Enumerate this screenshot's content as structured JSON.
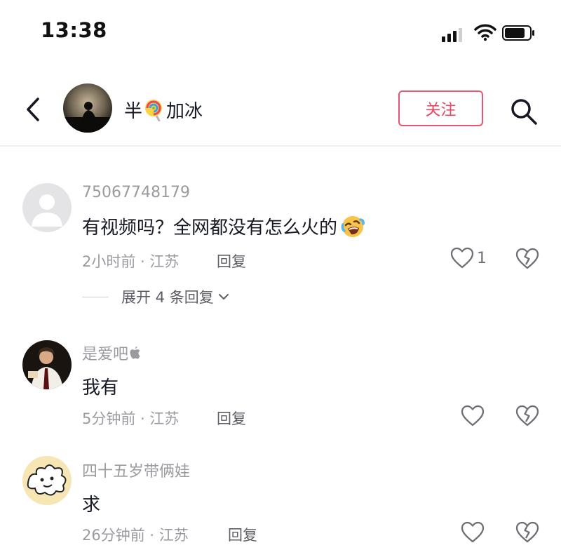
{
  "status_bar": {
    "time": "13:38"
  },
  "header": {
    "channel_name_prefix": "半",
    "channel_name_suffix": "加冰",
    "follow_label": "关注"
  },
  "comments": [
    {
      "username": "75067748179",
      "content": "有视频吗？全网都没有怎么火的",
      "time_location": "2小时前 · 江苏",
      "reply_label": "回复",
      "like_count": "1",
      "expand_label": "展开 4 条回复"
    },
    {
      "username": "是爱吧",
      "content": "我有",
      "time_location": "5分钟前 · 江苏",
      "reply_label": "回复"
    },
    {
      "username": "四十五岁带俩娃",
      "content": "求",
      "time_location": "26分钟前 · 江苏",
      "reply_label": "回复"
    }
  ],
  "icons": {
    "back": "chevron-left-icon",
    "search": "search-icon",
    "like": "heart-outline-icon",
    "dislike": "broken-heart-icon",
    "lollipop": "lollipop-emoji",
    "laugh": "rolling-laughing-emoji",
    "apple": "apple-logo-icon"
  },
  "colors": {
    "follow_accent": "#e84663",
    "meta_gray": "#9a9aa0"
  }
}
